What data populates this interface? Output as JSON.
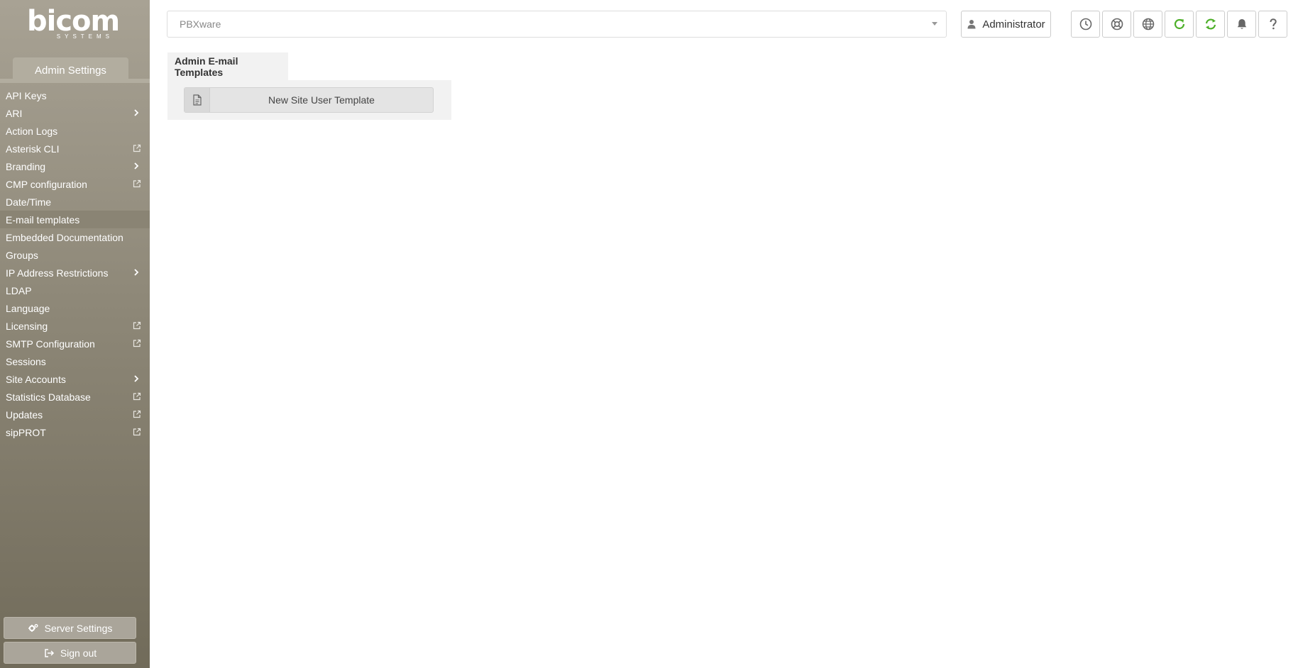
{
  "brand": {
    "logo_word": "bicom",
    "logo_sub": "SYSTEMS"
  },
  "sidebar": {
    "title": "Admin Settings",
    "items": [
      {
        "label": "API Keys",
        "suffix": ""
      },
      {
        "label": "ARI",
        "suffix": "chevron"
      },
      {
        "label": "Action Logs",
        "suffix": ""
      },
      {
        "label": "Asterisk CLI",
        "suffix": "external"
      },
      {
        "label": "Branding",
        "suffix": "chevron"
      },
      {
        "label": "CMP configuration",
        "suffix": "external"
      },
      {
        "label": "Date/Time",
        "suffix": ""
      },
      {
        "label": "E-mail templates",
        "suffix": "",
        "active": true
      },
      {
        "label": "Embedded Documentation",
        "suffix": ""
      },
      {
        "label": "Groups",
        "suffix": ""
      },
      {
        "label": "IP Address Restrictions",
        "suffix": "chevron"
      },
      {
        "label": "LDAP",
        "suffix": ""
      },
      {
        "label": "Language",
        "suffix": ""
      },
      {
        "label": "Licensing",
        "suffix": "external"
      },
      {
        "label": "SMTP Configuration",
        "suffix": "external"
      },
      {
        "label": "Sessions",
        "suffix": ""
      },
      {
        "label": "Site Accounts",
        "suffix": "chevron"
      },
      {
        "label": "Statistics Database",
        "suffix": "external"
      },
      {
        "label": "Updates",
        "suffix": "external"
      },
      {
        "label": "sipPROT",
        "suffix": "external"
      }
    ],
    "server_settings_label": "Server Settings",
    "sign_out_label": "Sign out"
  },
  "header": {
    "select_value": "PBXware",
    "user_label": "Administrator",
    "icons": [
      "clock-icon",
      "support-icon",
      "globe-icon",
      "reload-icon",
      "sync-icon",
      "bell-icon",
      "help-icon"
    ]
  },
  "main": {
    "tab_label": "Admin E-mail Templates",
    "new_template_label": "New Site User Template"
  },
  "colors": {
    "green_accent": "#4caf27",
    "sidebar_top": "#a8a294",
    "sidebar_bottom": "#716b5a"
  }
}
